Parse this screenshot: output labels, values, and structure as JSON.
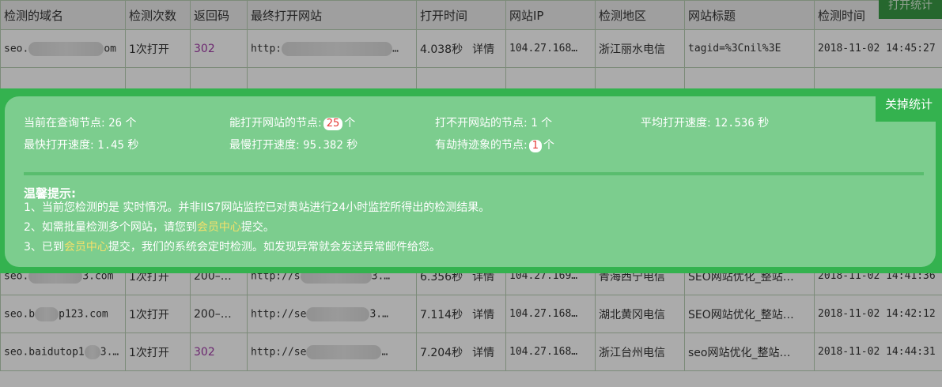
{
  "table": {
    "headers": [
      "检测的域名",
      "检测次数",
      "返回码",
      "最终打开网站",
      "打开时间",
      "网站IP",
      "检测地区",
      "网站标题",
      "检测时间"
    ],
    "rows": [
      {
        "domain_pre": "seo.",
        "domain_post": "om",
        "times": "1次打开",
        "code": "302",
        "url_pre": "http:",
        "url_post": "…",
        "time": "4.038秒",
        "detail": "详情",
        "ip": "104.27.168…",
        "region": "浙江丽水电信",
        "title": "tagid=%3Cnil%3E",
        "checked": "2018-11-02 14:45:27"
      },
      {
        "domain_pre": "seo.",
        "domain_post": "3.com",
        "times": "1次打开",
        "code": "200–…",
        "url_pre": "http://s",
        "url_post": "3.…",
        "time": "6.356秒",
        "detail": "详情",
        "ip": "104.27.169…",
        "region": "青海西宁电信",
        "title": "SEO网站优化_整站…",
        "checked": "2018-11-02 14:41:36"
      },
      {
        "domain_pre": "seo.b",
        "domain_post": "p123.com",
        "times": "1次打开",
        "code": "200–…",
        "url_pre": "http://se",
        "url_post": "3.…",
        "time": "7.114秒",
        "detail": "详情",
        "ip": "104.27.168…",
        "region": "湖北黄冈电信",
        "title": "SEO网站优化_整站…",
        "checked": "2018-11-02 14:42:12"
      },
      {
        "domain_pre": "seo.baidutop1",
        "domain_post": "3.com",
        "times": "1次打开",
        "code": "302",
        "url_pre": "http://se",
        "url_post": "…",
        "time": "7.204秒",
        "detail": "详情",
        "ip": "104.27.168…",
        "region": "浙江台州电信",
        "title": "seo网站优化_整站…",
        "checked": "2018-11-02 14:44:31"
      }
    ],
    "top_button": "打开统计"
  },
  "popup": {
    "close_label": "关掉统计",
    "stats": {
      "querying_label": "当前在查询节点:",
      "querying_value": "26",
      "querying_unit": "个",
      "open_label": "能打开网站的节点:",
      "open_value": "25",
      "open_unit": "个",
      "fail_label": "打不开网站的节点:",
      "fail_value": "1",
      "fail_unit": "个",
      "avg_label": "平均打开速度:",
      "avg_value": "12.536",
      "avg_unit": "秒",
      "fast_label": "最快打开速度:",
      "fast_value": "1.45",
      "fast_unit": "秒",
      "slow_label": "最慢打开速度:",
      "slow_value": "95.382",
      "slow_unit": "秒",
      "hijack_label": "有劫持迹象的节点:",
      "hijack_value": "1",
      "hijack_unit": "个"
    },
    "tips_title": "温馨提示:",
    "tip1": "1、当前您检测的是 实时情况。并非IIS7网站监控已对贵站进行24小时监控所得出的检测结果。",
    "tip2_pre": "2、如需批量检测多个网站，请您到",
    "tip2_link": "会员中心",
    "tip2_post": "提交。",
    "tip3_pre": "3、已到",
    "tip3_link": "会员中心",
    "tip3_post": "提交，我们的系统会定时检测。如发现异常就会发送异常邮件给您。"
  }
}
